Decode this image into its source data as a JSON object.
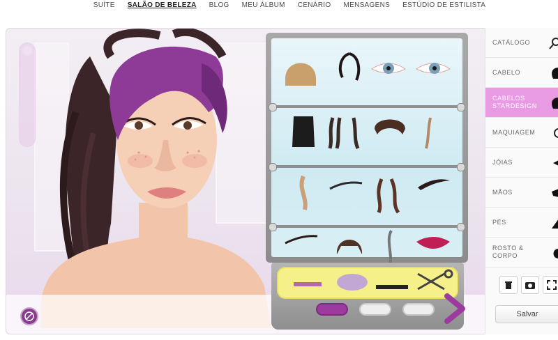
{
  "nav": {
    "items": [
      {
        "label": "SUÍTE",
        "active": false
      },
      {
        "label": "SALÃO DE BELEZA",
        "active": true
      },
      {
        "label": "BLOG",
        "active": false
      },
      {
        "label": "MEU ÁLBUM",
        "active": false
      },
      {
        "label": "CENÁRIO",
        "active": false
      },
      {
        "label": "MENSAGENS",
        "active": false
      },
      {
        "label": "ESTÚDIO DE ESTILISTA",
        "active": false
      }
    ]
  },
  "sidebar": {
    "categories": [
      {
        "label": "CATÁLOGO",
        "icon": "magnifier-icon"
      },
      {
        "label": "CABELO",
        "icon": "hair-silhouette-icon"
      },
      {
        "label": "CABELOS STARDESIGN",
        "icon": "hair-silhouette-icon",
        "active": true
      },
      {
        "label": "MAQUIAGEM",
        "icon": "face-icon"
      },
      {
        "label": "JÓIAS",
        "icon": "jewel-icon"
      },
      {
        "label": "MÃOS",
        "icon": "hand-icon"
      },
      {
        "label": "PÉS",
        "icon": "foot-icon"
      },
      {
        "label": "ROSTO & CORPO",
        "icon": "face-icon"
      }
    ],
    "tools": [
      "trash-icon",
      "camera-icon",
      "fullscreen-icon"
    ],
    "save_label": "Salvar"
  },
  "closet": {
    "current_page": 1,
    "page_count": 3,
    "accent": "#9d3aa0"
  },
  "colors": {
    "active_category": "#e89be3",
    "brand_purple": "#9d3aa0"
  }
}
